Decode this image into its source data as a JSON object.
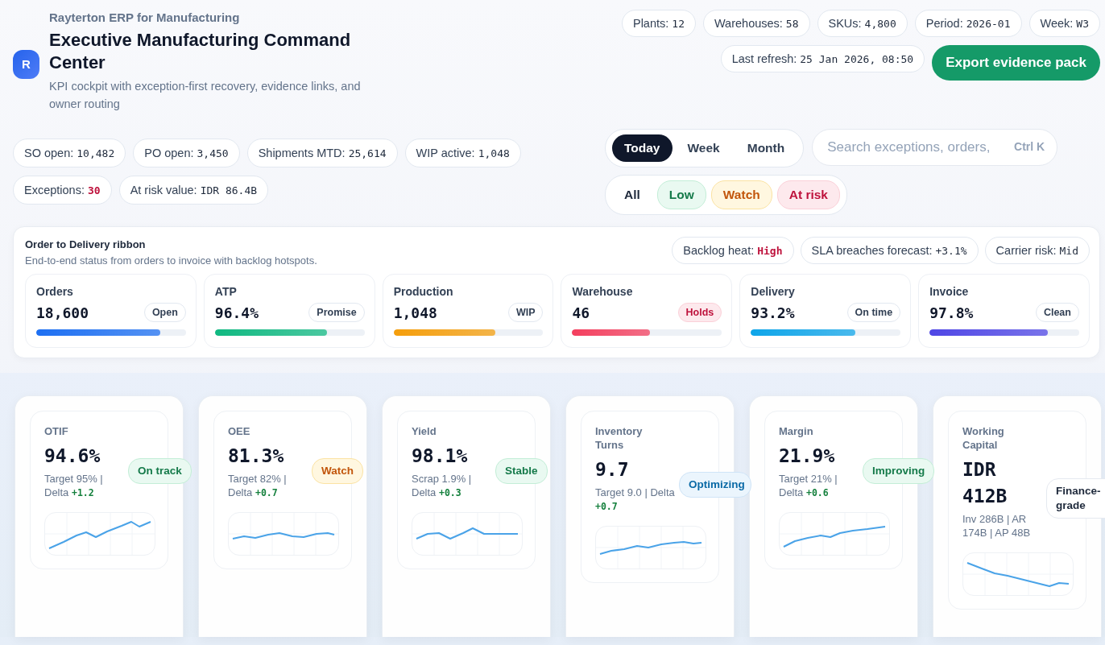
{
  "app": {
    "product": "Rayterton ERP for Manufacturing",
    "logo": "R",
    "title": "Executive Manufacturing Command Center",
    "subtitle": "KPI cockpit with exception-first recovery, evidence links, and owner routing"
  },
  "meta_chips": [
    {
      "label": "Plants:",
      "value": "12"
    },
    {
      "label": "Warehouses:",
      "value": "58"
    },
    {
      "label": "SKUs:",
      "value": "4,800"
    },
    {
      "label": "Period:",
      "value": "2026-01"
    },
    {
      "label": "Week:",
      "value": "W3"
    }
  ],
  "last_refresh": {
    "label": "Last refresh:",
    "value": "25 Jan 2026, 08:50"
  },
  "export_button": "Export evidence pack",
  "summary_chips": [
    {
      "label": "SO open:",
      "value": "10,482",
      "alert": false
    },
    {
      "label": "PO open:",
      "value": "3,450",
      "alert": false
    },
    {
      "label": "Shipments MTD:",
      "value": "25,614",
      "alert": false
    },
    {
      "label": "WIP active:",
      "value": "1,048",
      "alert": false
    },
    {
      "label": "Exceptions:",
      "value": "30",
      "alert": true
    },
    {
      "label": "At risk value:",
      "value": "IDR 86.4B",
      "alert": false
    }
  ],
  "period_tabs": [
    {
      "label": "Today",
      "selected": true
    },
    {
      "label": "Week",
      "selected": false
    },
    {
      "label": "Month",
      "selected": false
    }
  ],
  "search": {
    "placeholder": "Search exceptions, orders,",
    "shortcut": "Ctrl K"
  },
  "risk_filters": [
    {
      "label": "All",
      "kind": "neutral",
      "selected": false
    },
    {
      "label": "Low",
      "kind": "good",
      "selected": false
    },
    {
      "label": "Watch",
      "kind": "watch",
      "selected": false
    },
    {
      "label": "At risk",
      "kind": "danger",
      "selected": false
    }
  ],
  "ribbon": {
    "title": "Order to Delivery ribbon",
    "subtitle": "End-to-end status from orders to invoice with backlog hotspots.",
    "signals": [
      {
        "label": "Backlog heat:",
        "value": "High",
        "alert": true
      },
      {
        "label": "SLA breaches forecast:",
        "value": "+3.1%",
        "alert": false
      },
      {
        "label": "Carrier risk:",
        "value": "Mid",
        "alert": false
      }
    ],
    "stages": [
      {
        "label": "Orders",
        "value": "18,600",
        "tag": "Open",
        "alert": false,
        "level": 0.83,
        "color": "#1d6ff2"
      },
      {
        "label": "ATP",
        "value": "96.4%",
        "tag": "Promise",
        "alert": false,
        "level": 0.75,
        "color": "#10b981"
      },
      {
        "label": "Production",
        "value": "1,048",
        "tag": "WIP",
        "alert": false,
        "level": 0.68,
        "color": "#f59e0b"
      },
      {
        "label": "Warehouse",
        "value": "46",
        "tag": "Holds",
        "alert": true,
        "level": 0.52,
        "color": "#f43f5e"
      },
      {
        "label": "Delivery",
        "value": "93.2%",
        "tag": "On time",
        "alert": false,
        "level": 0.7,
        "color": "#0ea5e9"
      },
      {
        "label": "Invoice",
        "value": "97.8%",
        "tag": "Clean",
        "alert": false,
        "level": 0.79,
        "color": "#4f46e5"
      }
    ]
  },
  "kpis": [
    {
      "label": "OTIF",
      "value": "94.6%",
      "status": "On track",
      "kind": "good",
      "note": "Target 95% | Delta",
      "delta": "+1.2"
    },
    {
      "label": "OEE",
      "value": "81.3%",
      "status": "Watch",
      "kind": "watch",
      "note": "Target 82% | Delta",
      "delta": "+0.7"
    },
    {
      "label": "Yield",
      "value": "98.1%",
      "status": "Stable",
      "kind": "good",
      "note": "Scrap 1.9% | Delta",
      "delta": "+0.3"
    },
    {
      "label": "Inventory Turns",
      "value": "9.7",
      "status": "Optimizing",
      "kind": "info",
      "note": "Target 9.0 | Delta",
      "delta": "+0.7"
    },
    {
      "label": "Margin",
      "value": "21.9%",
      "status": "Improving",
      "kind": "good",
      "note": "Target 21% | Delta",
      "delta": "+0.6"
    },
    {
      "label": "Working Capital",
      "value": "IDR 412B",
      "status": "Finance-grade",
      "kind": "neutral",
      "note": "Inv 286B | AR 174B | AP 48B"
    }
  ]
}
